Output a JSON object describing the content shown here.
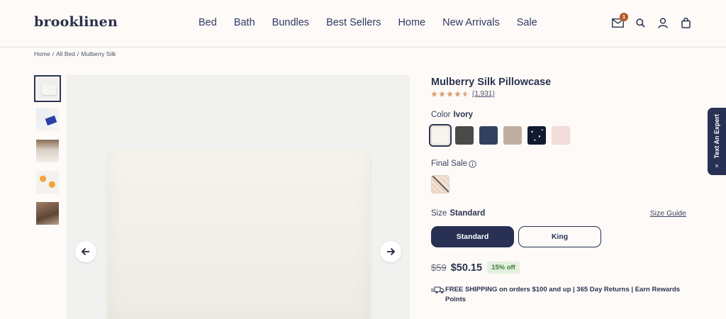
{
  "brand": {
    "logo": "brooklinen"
  },
  "nav": {
    "items": [
      "Bed",
      "Bath",
      "Bundles",
      "Best Sellers",
      "Home",
      "New Arrivals",
      "Sale"
    ]
  },
  "header_icons": {
    "mail_badge": "1",
    "icons": [
      "mail-icon",
      "search-icon",
      "account-icon",
      "bag-icon"
    ]
  },
  "breadcrumb": {
    "items": [
      "Home",
      "/",
      "All Bed",
      "/",
      "Mulberry Silk"
    ]
  },
  "gallery": {
    "thumbnails": [
      "pillowcase-front",
      "pillowcase-packaging",
      "bed-lifestyle",
      "flowers-lifestyle",
      "bed-dark"
    ]
  },
  "product": {
    "title": "Mulberry Silk Pillowcase",
    "rating": 4.5,
    "review_count": "(1,931)",
    "color_label": "Color",
    "color_value": "Ivory",
    "colors": [
      "#f7f5f0",
      "#4a4a48",
      "#34415e",
      "#bfae9f",
      "#111a2e",
      "#f1dddb"
    ],
    "final_sale_label": "Final Sale",
    "size_label": "Size",
    "size_value": "Standard",
    "size_guide": "Size Guide",
    "sizes": [
      "Standard",
      "King"
    ],
    "old_price": "$59",
    "new_price": "$50.15",
    "discount": "15% off",
    "shipping": "FREE SHIPPING on orders $100 and up | 365 Day Returns | Earn Rewards Points"
  },
  "expert_tab": {
    "label": "Text An Expert",
    "close": "×"
  },
  "colors": {
    "primary": "#283154",
    "badge": "#b5582a",
    "star": "#d9a176",
    "discount_bg": "#e3f0df",
    "discount_text": "#3d7a3a"
  }
}
